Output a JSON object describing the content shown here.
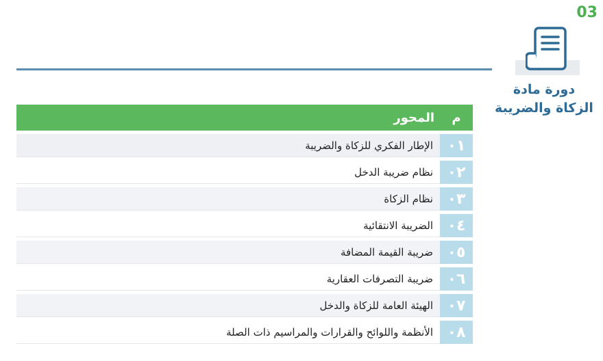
{
  "header": {
    "section_number": "03",
    "icon": "document-scroll-icon",
    "course_title_line1": "دورة مادة",
    "course_title_line2": "الزكاة والضريبة"
  },
  "colors": {
    "accent_green": "#4CAF50",
    "table_header": "#5cb85c",
    "number_cell": "#b9dceb",
    "title_blue": "#2d6a96",
    "divider": "#5b8db0"
  },
  "table": {
    "columns": [
      "م",
      "المحور"
    ],
    "rows": [
      {
        "num": "٠١",
        "text": "الإطار الفكري للزكاة والضريبة"
      },
      {
        "num": "٠٢",
        "text": "نظام ضريبة الدخل"
      },
      {
        "num": "٠٣",
        "text": "نظام الزكاة"
      },
      {
        "num": "٠٤",
        "text": "الضريبة الانتقائية"
      },
      {
        "num": "٠٥",
        "text": "ضريبة القيمة المضافة"
      },
      {
        "num": "٠٦",
        "text": "ضريبة التصرفات العقارية"
      },
      {
        "num": "٠٧",
        "text": "الهيئة العامة للزكاة والدخل"
      },
      {
        "num": "٠٨",
        "text": "الأنظمة واللوائح والقرارات والمراسيم ذات الصلة"
      }
    ]
  }
}
